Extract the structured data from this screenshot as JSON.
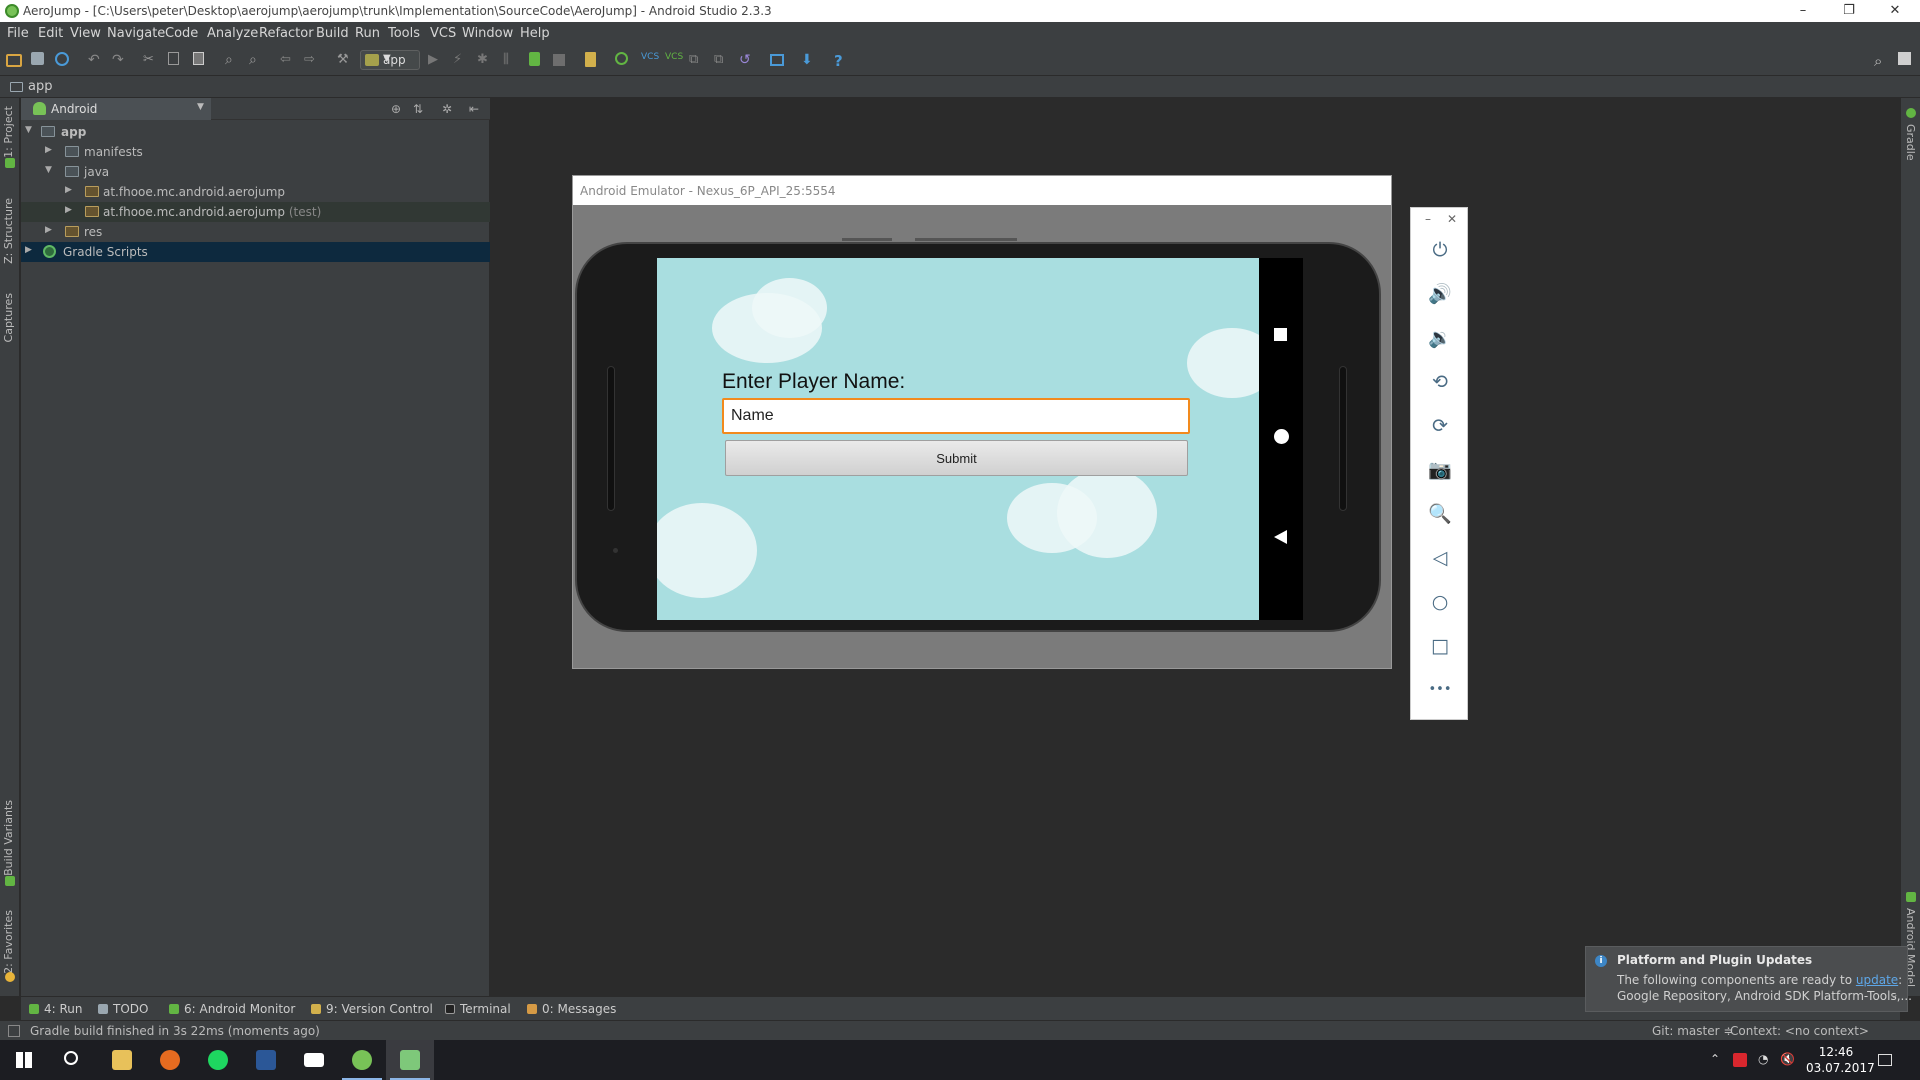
{
  "window": {
    "title": "AeroJump - [C:\\Users\\peter\\Desktop\\aerojump\\aerojump\\trunk\\Implementation\\SourceCode\\AeroJump] - Android Studio 2.3.3",
    "minimize": "–",
    "maximize": "❐",
    "close": "✕"
  },
  "menu": [
    "File",
    "Edit",
    "View",
    "Navigate",
    "Code",
    "Analyze",
    "Refactor",
    "Build",
    "Run",
    "Tools",
    "VCS",
    "Window",
    "Help"
  ],
  "toolbar": {
    "run_config": "app",
    "help": "?"
  },
  "breadcrumb": "app",
  "left_tabs": {
    "project": "1: Project",
    "structure": "Z: Structure",
    "captures": "Captures",
    "build_variants": "Build Variants",
    "favorites": "2: Favorites"
  },
  "right_tabs": {
    "gradle": "Gradle",
    "android_model": "Android Model"
  },
  "project_panel": {
    "view": "Android",
    "tree": [
      {
        "label": "app",
        "suffix": ""
      },
      {
        "label": "manifests",
        "suffix": ""
      },
      {
        "label": "java",
        "suffix": ""
      },
      {
        "label": "at.fhooe.mc.android.aerojump",
        "suffix": ""
      },
      {
        "label": "at.fhooe.mc.android.aerojump",
        "suffix": "(test)"
      },
      {
        "label": "res",
        "suffix": ""
      },
      {
        "label": "Gradle Scripts",
        "suffix": ""
      }
    ]
  },
  "emulator": {
    "title": "Android Emulator - Nexus_6P_API_25:5554",
    "app": {
      "prompt": "Enter Player Name:",
      "input_value": "Name",
      "submit": "Submit"
    },
    "tools_header": {
      "minimize": "–",
      "close": "✕"
    },
    "more": "•••"
  },
  "bottom_tabs": [
    "4: Run",
    "TODO",
    "6: Android Monitor",
    "9: Version Control",
    "Terminal",
    "0: Messages"
  ],
  "status": {
    "message": "Gradle build finished in 3s 22ms (moments ago)",
    "git": "Git: master ≑",
    "context": "Context: <no context>"
  },
  "notification": {
    "title": "Platform and Plugin Updates",
    "line1_prefix": "The following components are ready to ",
    "line1_link": "update",
    "line1_suffix": ":",
    "line2": "Google Repository, Android SDK Platform-Tools,..."
  },
  "taskbar": {
    "time": "12:46",
    "date": "03.07.2017"
  },
  "colors": {
    "ide_bg": "#2b2b2b",
    "panel_bg": "#3c3f41",
    "selection": "#0d293e",
    "input_focus": "#f28a1d",
    "sky": "#a9dee0"
  }
}
